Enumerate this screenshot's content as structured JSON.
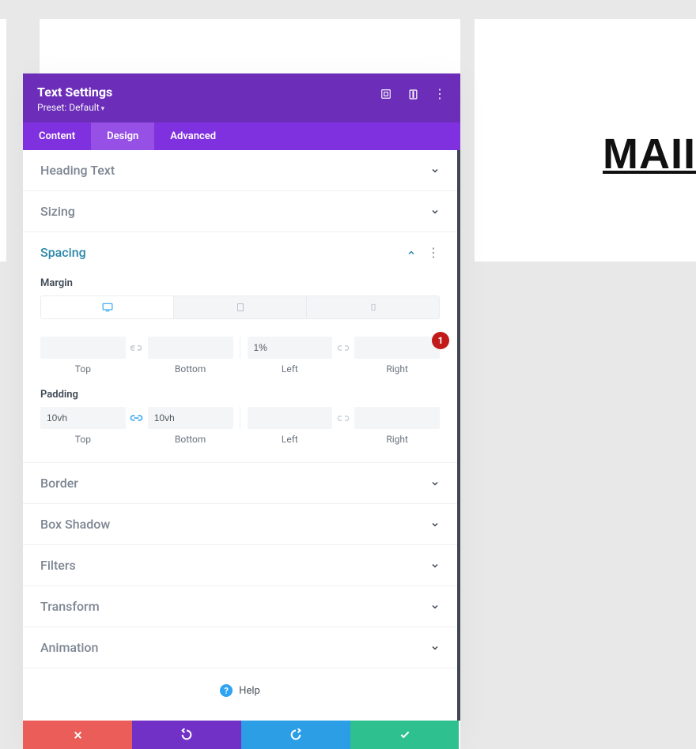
{
  "canvas": {
    "heading_preview": "MAII"
  },
  "modal": {
    "title": "Text Settings",
    "preset_label": "Preset: Default",
    "tabs": {
      "content": "Content",
      "design": "Design",
      "advanced": "Advanced",
      "active": "design"
    }
  },
  "sections": {
    "heading_text": "Heading Text",
    "sizing": "Sizing",
    "spacing": "Spacing",
    "border": "Border",
    "box_shadow": "Box Shadow",
    "filters": "Filters",
    "transform": "Transform",
    "animation": "Animation"
  },
  "spacing": {
    "margin_label": "Margin",
    "padding_label": "Padding",
    "captions": {
      "top": "Top",
      "bottom": "Bottom",
      "left": "Left",
      "right": "Right"
    },
    "margin": {
      "top": "",
      "bottom": "",
      "left": "1%",
      "right": "",
      "link_tb": false,
      "link_lr": false
    },
    "padding": {
      "top": "10vh",
      "bottom": "10vh",
      "left": "",
      "right": "",
      "link_tb": true,
      "link_lr": false
    },
    "annotation": "1"
  },
  "help": {
    "label": "Help"
  }
}
